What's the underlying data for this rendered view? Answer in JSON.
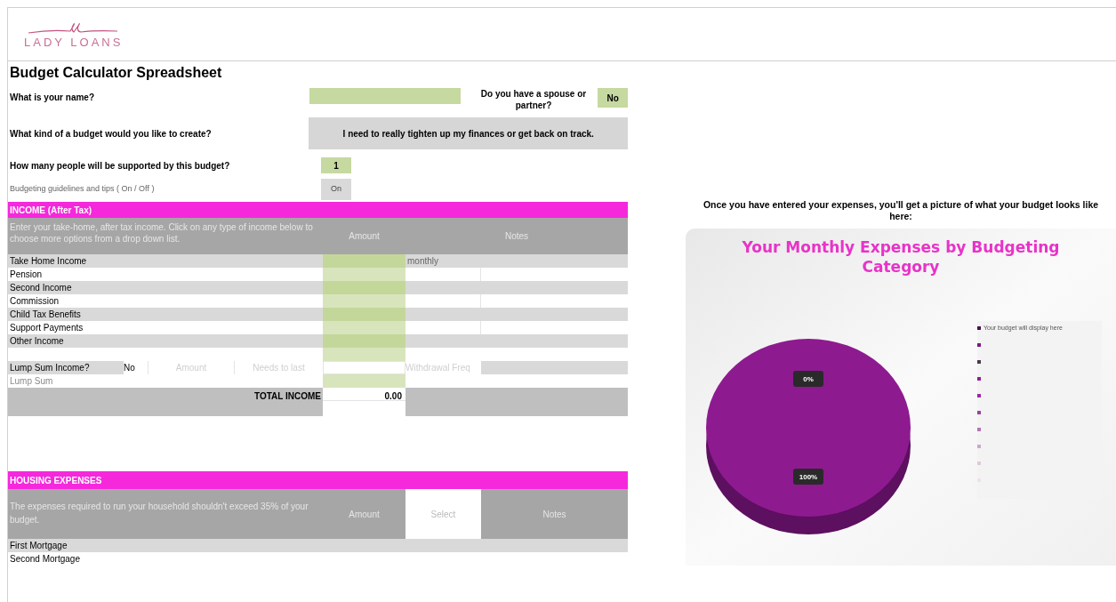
{
  "logo": {
    "text": "LADY LOANS"
  },
  "title": "Budget Calculator Spreadsheet",
  "questions": {
    "name_label": "What is your name?",
    "spouse_label": "Do you have a spouse or partner?",
    "spouse_value": "No",
    "budget_label": "What kind of a budget would you like to create?",
    "budget_value": "I need to really tighten up my finances or get back on track.",
    "people_label": "How many people will be supported by this budget?",
    "people_value": "1",
    "tips_label": "Budgeting guidelines and tips ( On / Off )",
    "tips_value": "On"
  },
  "income": {
    "title": "INCOME (After Tax)",
    "description": "Enter your take-home, after tax income. Click on any type of income below to choose more options from a drop down list.",
    "columns": [
      "Amount",
      "Notes"
    ],
    "rows": [
      {
        "label": "Take Home Income",
        "note": "monthly"
      },
      {
        "label": "Pension"
      },
      {
        "label": "Second Income"
      },
      {
        "label": "Commission"
      },
      {
        "label": "Child Tax Benefits"
      },
      {
        "label": "Support Payments"
      },
      {
        "label": "Other Income"
      }
    ],
    "lump_sum": {
      "label": "Lump Sum Income?",
      "value": "No",
      "amount_header": "Amount",
      "needs_header": "Needs to last",
      "withdrawal_header": "Withdrawal Freq",
      "row_label": "Lump Sum"
    },
    "total_label": "TOTAL INCOME",
    "total_value": "0.00"
  },
  "housing": {
    "title": "HOUSING EXPENSES",
    "description": "The expenses required to run your household shouldn't exceed 35% of your budget.",
    "columns": [
      "Amount",
      "Select",
      "Notes"
    ],
    "rows": [
      {
        "label": "First Mortgage"
      },
      {
        "label": "Second Mortgage"
      }
    ]
  },
  "chart_intro": "Once you have entered your expenses, you'll get a picture of what your budget looks like here:",
  "chart": {
    "chart_data": {
      "type": "pie",
      "title": "Your Monthly Expenses by Budgeting Category",
      "values": [
        0,
        100
      ],
      "value_labels": [
        "0%",
        "100%"
      ]
    },
    "legend": [
      {
        "label": "Your budget will display here",
        "color": "#4a0f4e"
      },
      {
        "color": "#7a1a7d"
      },
      {
        "color": "#4b3a4c"
      },
      {
        "color": "#8e1f92"
      },
      {
        "color": "#9a2a9e"
      },
      {
        "color": "#a040a3"
      },
      {
        "color": "#b277b4"
      },
      {
        "color": "#c9aaca"
      },
      {
        "color": "#dccadd"
      },
      {
        "color": "#ebe3eb"
      }
    ]
  }
}
